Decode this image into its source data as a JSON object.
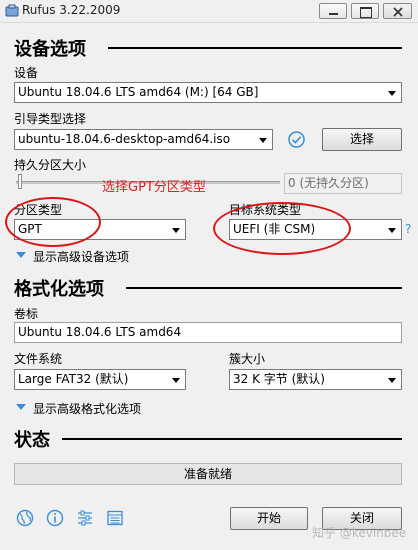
{
  "window": {
    "title": "Rufus 3.22.2009",
    "minimize_label": "—",
    "maximize_label": "▢",
    "close_label": "✕"
  },
  "drive_section": {
    "title": "设备选项",
    "device_label": "设备",
    "device_value": "Ubuntu 18.04.6 LTS amd64 (M:) [64 GB]",
    "boot_selection_label": "引导类型选择",
    "boot_selection_value": "ubuntu-18.04.6-desktop-amd64.iso",
    "select_button": "选择",
    "persistent_label": "持久分区大小",
    "persistent_value": "0 (无持久分区)",
    "persistent_slider_level": 0,
    "partition_scheme_label": "分区类型",
    "partition_scheme_value": "GPT",
    "target_system_label": "目标系统类型",
    "target_system_value": "UEFI (非 CSM)",
    "help_mark": "?",
    "advanced_toggle": "显示高级设备选项"
  },
  "annotation": {
    "text": "选择GPT分区类型",
    "color": "#e02020"
  },
  "format_section": {
    "title": "格式化选项",
    "volume_label_label": "卷标",
    "volume_label_value": "Ubuntu 18.04.6 LTS amd64",
    "filesystem_label": "文件系统",
    "filesystem_value": "Large FAT32 (默认)",
    "cluster_label": "簇大小",
    "cluster_value": "32 K 字节 (默认)",
    "advanced_toggle": "显示高级格式化选项"
  },
  "status_section": {
    "title": "状态",
    "status_text": "准备就绪"
  },
  "footer": {
    "icons": [
      "globe-icon",
      "info-icon",
      "settings-sliders-icon",
      "log-icon"
    ],
    "start_button": "开始",
    "close_button": "关闭",
    "watermark": "知乎 @kevinbee"
  },
  "colors": {
    "window_bg": "#f0f0f0",
    "accent_blue": "#3a8fd8",
    "annotation_red": "#d81818"
  }
}
